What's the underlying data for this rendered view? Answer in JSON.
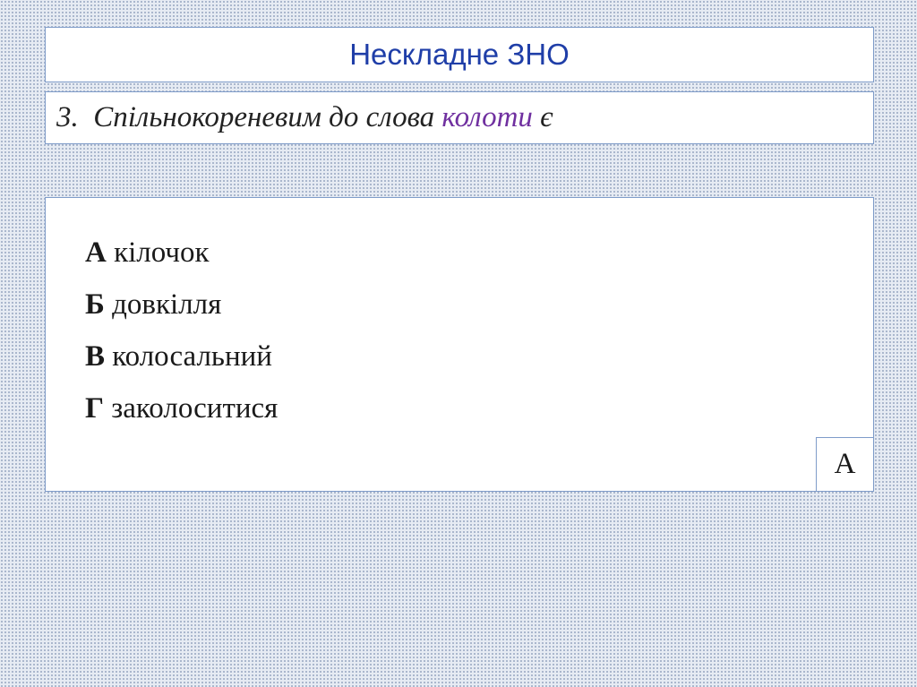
{
  "title": "Нескладне ЗНО",
  "question": {
    "prefix": "3.  Спільнокореневим до слова ",
    "highlight": "колоти",
    "suffix": " є"
  },
  "options": [
    {
      "letter": "А",
      "text": " кілочок"
    },
    {
      "letter": "Б",
      "text": " довкілля"
    },
    {
      "letter": "В",
      "text": " колосальний"
    },
    {
      "letter": "Г",
      "text": " заколоситися"
    }
  ],
  "answer": "А",
  "colors": {
    "title": "#1f3ea8",
    "highlight": "#7030a0",
    "border": "#7f9cc9"
  }
}
